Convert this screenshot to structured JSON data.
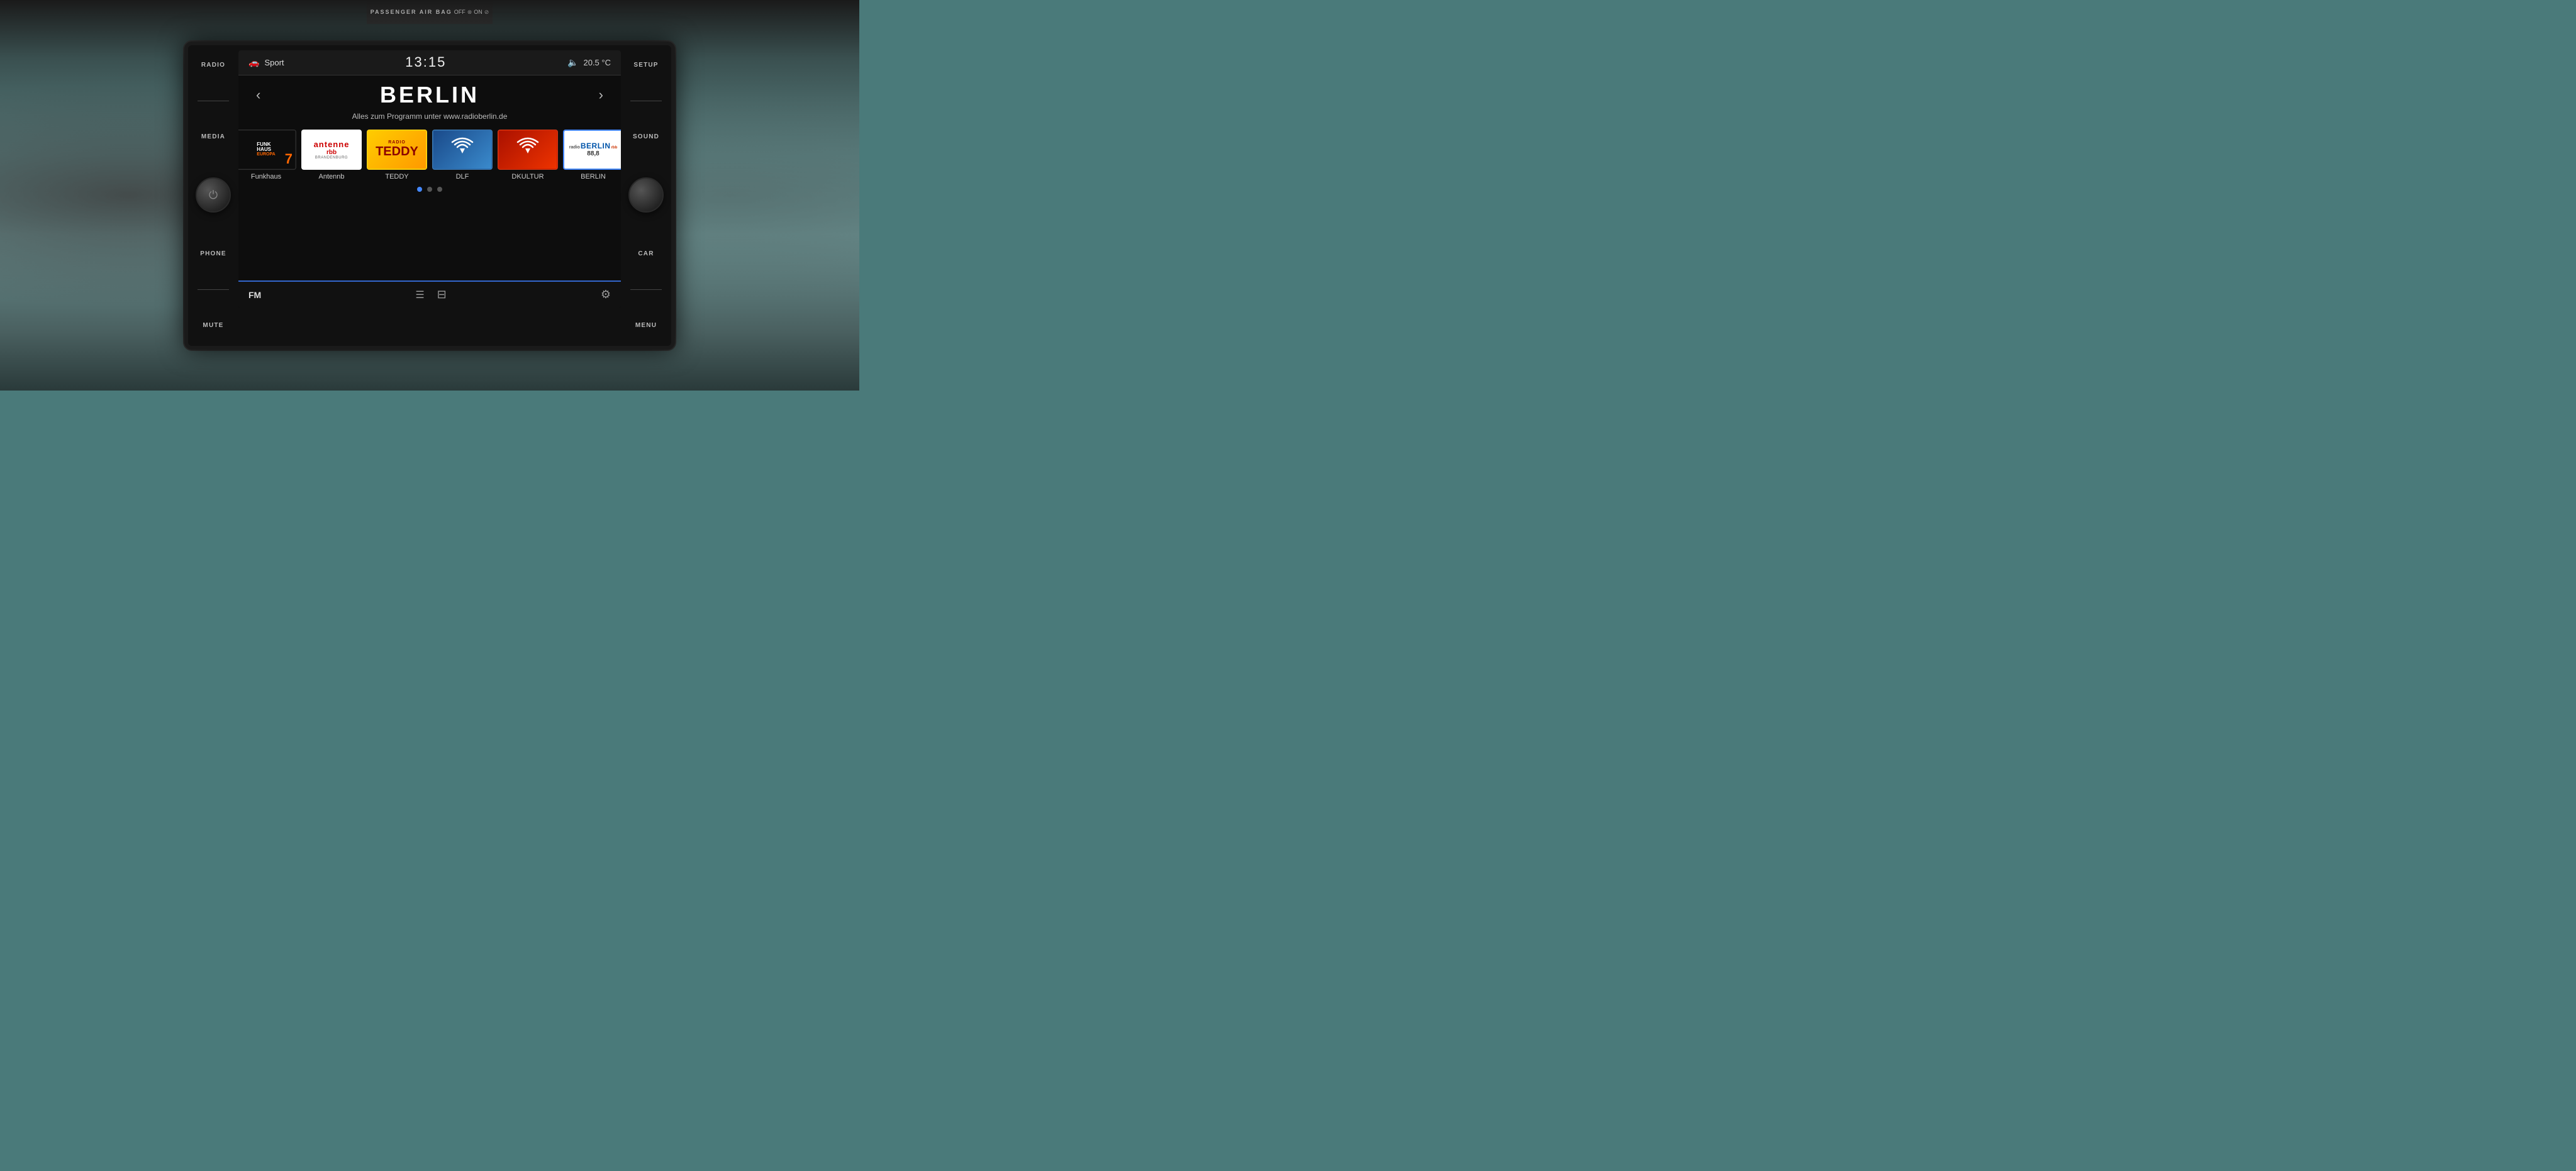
{
  "dashboard": {
    "airbag_label": "PASSENGER AIR BAG",
    "airbag_status": "OFF",
    "airbag_on": "ON"
  },
  "left_buttons": {
    "radio": "RADIO",
    "media": "MEDIA",
    "phone": "PHONE",
    "mute": "MUTE"
  },
  "right_buttons": {
    "setup": "SETUP",
    "sound": "SOUND",
    "car": "CAR",
    "menu": "MENU"
  },
  "status_bar": {
    "drive_mode": "Sport",
    "time": "13:15",
    "temperature": "20.5 °C"
  },
  "radio": {
    "station_name": "BERLIN",
    "station_info": "Alles zum Programm unter www.radioberlin.de",
    "bottom_band": "FM"
  },
  "stations": [
    {
      "id": "funkhaus",
      "label": "Funkhaus",
      "logo_line1": "FUNK",
      "logo_line2": "HAUS",
      "logo_line3": "EUROPA"
    },
    {
      "id": "antenne",
      "label": "Antennb",
      "logo_main": "antenne",
      "logo_sub": "rbb"
    },
    {
      "id": "teddy",
      "label": "TEDDY",
      "logo_main": "TEDDY"
    },
    {
      "id": "dlf",
      "label": "DLF",
      "logo_icon": "wifi"
    },
    {
      "id": "dkultur",
      "label": "DKULTUR",
      "logo_icon": "wifi"
    },
    {
      "id": "berlin",
      "label": "BERLIN",
      "logo_main": "radioBERLIN",
      "logo_sub": "88,8",
      "selected": true
    }
  ],
  "pagination": {
    "total": 3,
    "active": 0
  }
}
